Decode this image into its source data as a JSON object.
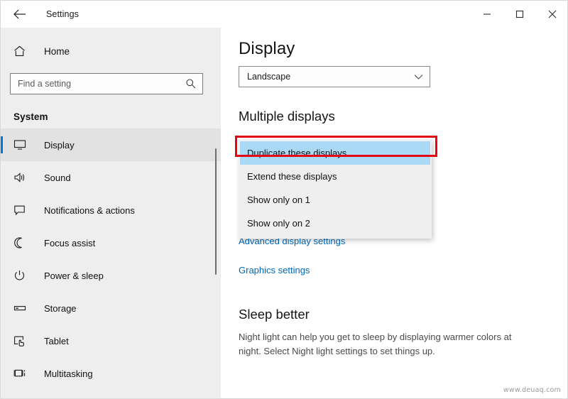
{
  "window": {
    "title": "Settings",
    "back_icon": "back-arrow-icon",
    "minimize_label": "Minimize",
    "maximize_label": "Maximize",
    "close_label": "Close"
  },
  "sidebar": {
    "home_label": "Home",
    "home_icon": "home-icon",
    "search": {
      "placeholder": "Find a setting",
      "value": "",
      "icon": "search-icon"
    },
    "section_title": "System",
    "items": [
      {
        "label": "Display",
        "icon": "monitor-icon",
        "selected": true
      },
      {
        "label": "Sound",
        "icon": "speaker-icon",
        "selected": false
      },
      {
        "label": "Notifications & actions",
        "icon": "chat-bubble-icon",
        "selected": false
      },
      {
        "label": "Focus assist",
        "icon": "moon-icon",
        "selected": false
      },
      {
        "label": "Power & sleep",
        "icon": "power-icon",
        "selected": false
      },
      {
        "label": "Storage",
        "icon": "drive-icon",
        "selected": false
      },
      {
        "label": "Tablet",
        "icon": "tablet-hand-icon",
        "selected": false
      },
      {
        "label": "Multitasking",
        "icon": "multitasking-icon",
        "selected": false
      }
    ]
  },
  "main": {
    "page_title": "Display",
    "orientation": {
      "value": "Landscape",
      "arrow_icon": "chevron-down-icon"
    },
    "multiple_displays_heading": "Multiple displays",
    "dropdown": {
      "options": [
        "Duplicate these displays",
        "Extend these displays",
        "Show only on 1",
        "Show only on 2"
      ],
      "highlighted_index": 0,
      "highlight_color": "#a9d9f5",
      "annotation_color": "#e30613"
    },
    "links": [
      "Advanced display settings",
      "Graphics settings"
    ],
    "sleep": {
      "heading": "Sleep better",
      "body": "Night light can help you get to sleep by displaying warmer colors at night. Select Night light settings to set things up."
    }
  },
  "watermark": "www.deuaq.com",
  "colors": {
    "accent": "#0078d7",
    "link": "#0067b8",
    "sidebar_bg": "#eeeeee",
    "dropdown_bg": "#efefef"
  }
}
